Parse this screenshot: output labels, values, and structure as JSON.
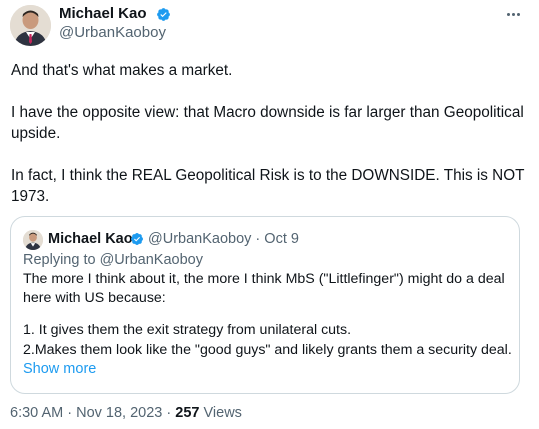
{
  "author": {
    "name": "Michael Kao",
    "handle": "@UrbanKaoboy"
  },
  "tweet": {
    "paragraphs": [
      "And that's what makes a market.",
      "I have the opposite view: that Macro downside is far larger than Geopolitical upside.",
      "In fact, I think the REAL Geopolitical Risk is to the DOWNSIDE. This is NOT 1973."
    ],
    "time": "6:30 AM",
    "date": "Nov 18, 2023",
    "separator": "·",
    "views_count": "257",
    "views_label": "Views"
  },
  "quote": {
    "name": "Michael Kao",
    "handle": "@UrbanKaoboy",
    "separator": "·",
    "date": "Oct 9",
    "replying_to": "Replying to @UrbanKaoboy",
    "lines": [
      "The more I think about it, the more I think MbS (\"Littlefinger\") might do a deal",
      "here with US because:",
      "1.  It gives them the exit strategy from unilateral cuts.",
      "2.Makes them look like the \"good guys\" and likely grants them a security deal..."
    ],
    "show_more": "Show more"
  },
  "icons": {
    "verified": "verified-badge-icon",
    "more": "more-horizontal-icon"
  },
  "colors": {
    "accent": "#1d9bf0",
    "secondary_text": "#536471",
    "primary_text": "#0f1419",
    "border": "#cfd9de"
  }
}
